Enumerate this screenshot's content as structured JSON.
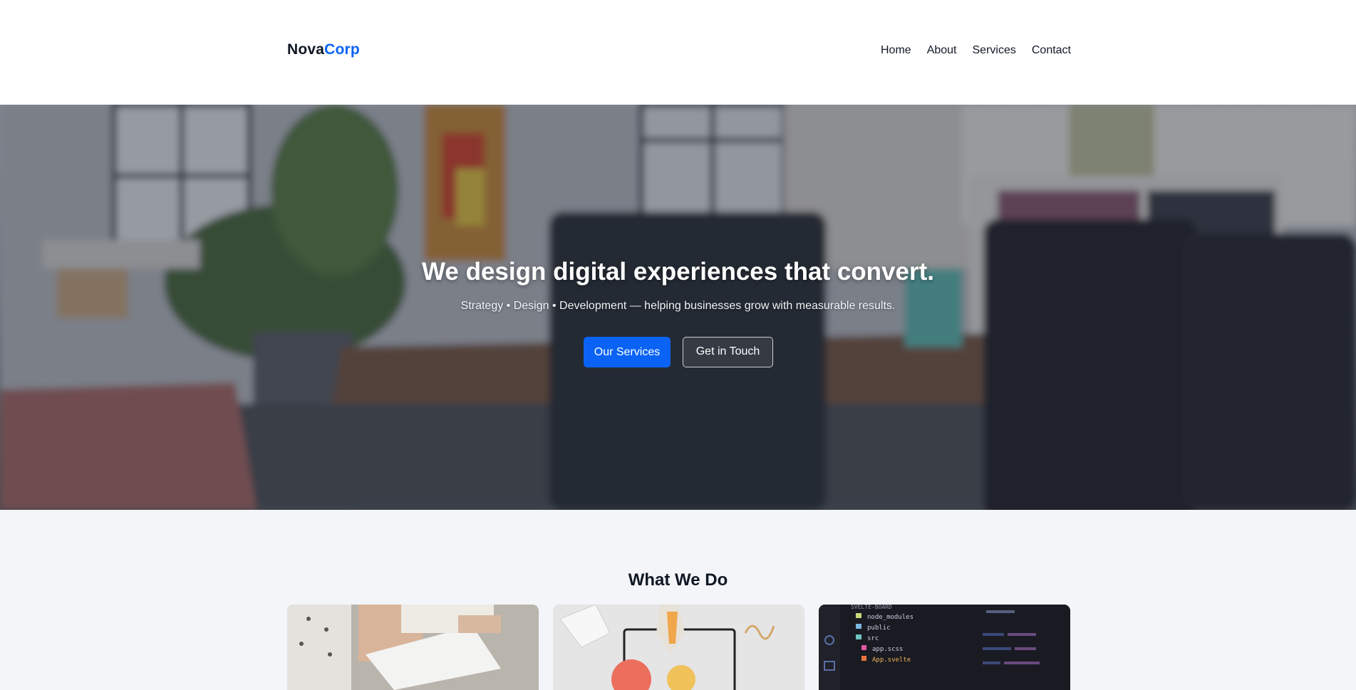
{
  "header": {
    "logo_primary": "Nova",
    "logo_accent": "Corp",
    "nav": [
      "Home",
      "About",
      "Services",
      "Contact"
    ]
  },
  "hero": {
    "title": "We design digital experiences that convert.",
    "subtitle": "Strategy • Design • Development — helping businesses grow with measurable results.",
    "primary_button": "Our Services",
    "secondary_button": "Get in Touch"
  },
  "services": {
    "title": "What We Do",
    "code_card_files": [
      "node_modules",
      "public",
      "src",
      "app.scss",
      "App.svelte"
    ],
    "code_card_header": "SVELTE-BOARD"
  },
  "colors": {
    "accent": "#0b63f6",
    "text": "#0f1724",
    "page_bg": "#f4f5f9"
  }
}
